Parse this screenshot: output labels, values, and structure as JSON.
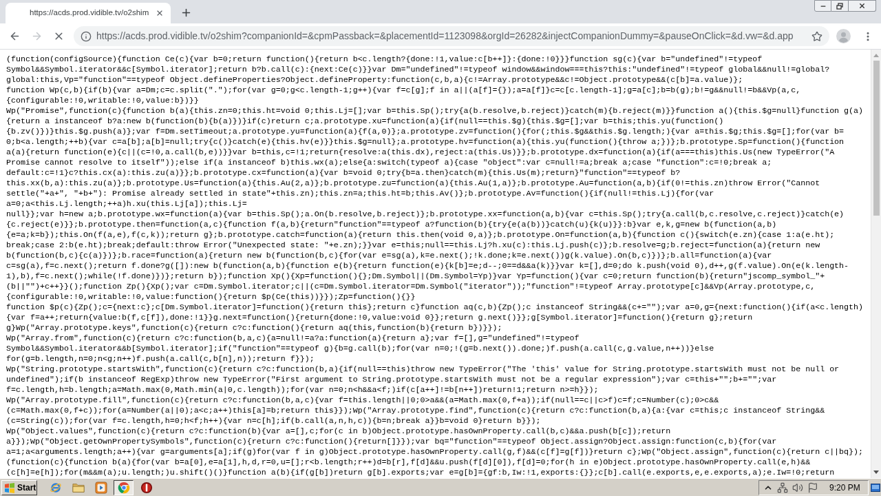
{
  "tabs": [
    {
      "title": "https://acds.prod.vidible.tv/o2shim",
      "selected": true
    }
  ],
  "toolbar": {
    "nav_buttons": [
      {
        "kind": "back",
        "disabled": false
      },
      {
        "kind": "forward",
        "disabled": true
      },
      {
        "kind": "stop",
        "disabled": false
      }
    ],
    "url": "https://acds.prod.vidible.tv/o2shim?companionId=&cpmPassback=&placementId=1123098&orgId=26282&injectCompanionDummy=&pauseOnClick=&d.vw=&d.app"
  },
  "page": {
    "code_lines": [
      "(function(configSource){function Ce(c){var b=0;return function(){return b<c.length?{done:!1,value:c[b++]}:{done:!0}}}function sg(c){var b=\"undefined\"!=typeof",
      "Symbol&&Symbol.iterator&&c[Symbol.iterator];return b?b.call(c):{next:Ce(c)}}var Dm=\"undefined\"!=typeof window&&window===this?this:\"undefined\"!=typeof global&&null!=global?",
      "global:this,Vp=\"function\"==typeof Object.defineProperties?Object.defineProperty:function(c,b,a){c!=Array.prototype&&c!=Object.prototype&&(c[b]=a.value)};",
      "function Wp(c,b){if(b){var a=Dm;c=c.split(\".\");for(var g=0;g<c.length-1;g++){var f=c[g];f in a||(a[f]={});a=a[f]}c=c[c.length-1];g=a[c];b=b(g);b!=g&&null!=b&&Vp(a,c,",
      "{configurable:!0,writable:!0,value:b})}}",
      "Wp(\"Promise\",function(c){function b(a){this.zn=0;this.ht=void 0;this.Lj=[];var b=this.Sp();try{a(b.resolve,b.reject)}catch(m){b.reject(m)}}function a(){this.$g=null}function g(a)",
      "{return a instanceof b?a:new b(function(b){b(a)})}if(c)return c;a.prototype.xu=function(a){if(null==this.$g){this.$g=[];var b=this;this.yu(function()",
      "{b.zv()})}this.$g.push(a)};var f=Dm.setTimeout;a.prototype.yu=function(a){f(a,0)};a.prototype.zv=function(){for(;this.$g&&this.$g.length;){var a=this.$g;this.$g=[];for(var b=",
      "0;b<a.length;++b){var c=a[b];a[b]=null;try{c()}catch(e){this.hv(e)}}this.$g=null};a.prototype.hv=function(a){this.yu(function(){throw a;})};b.prototype.Sp=function(){function",
      "a(a){return function(e){c||(c=!0,a.call(b,e))}}var b=this,c=!1;return{resolve:a(this.dx),reject:a(this.Us)}};b.prototype.dx=function(a){if(a===this)this.Us(new TypeError(\"A",
      "Promise cannot resolve to itself\"));else if(a instanceof b)this.wx(a);else{a:switch(typeof a){case \"object\":var c=null!=a;break a;case \"function\":c=!0;break a;",
      "default:c=!1}c?this.cx(a):this.zu(a)}};b.prototype.cx=function(a){var b=void 0;try{b=a.then}catch(m){this.Us(m);return}\"function\"==typeof b?",
      "this.xx(b,a):this.zu(a)};b.prototype.Us=function(a){this.Au(2,a)};b.prototype.zu=function(a){this.Au(1,a)};b.prototype.Au=function(a,b){if(0!=this.zn)throw Error(\"Cannot",
      "settle(\"+a+\", \"+b+\"): Promise already settled in state\"+this.zn);this.zn=a;this.ht=b;this.Av()};b.prototype.Av=function(){if(null!=this.Lj){for(var",
      "a=0;a<this.Lj.length;++a)h.xu(this.Lj[a]);this.Lj=",
      "null}};var h=new a;b.prototype.wx=function(a){var b=this.Sp();a.On(b.resolve,b.reject)};b.prototype.xx=function(a,b){var c=this.Sp();try{a.call(b,c.resolve,c.reject)}catch(e)",
      "{c.reject(e)}};b.prototype.then=function(a,c){function f(a,b){return\"function\"==typeof a?function(b){try{e(a(b))}catch(u){k(u)}}:b}var e,k,g=new b(function(a,b)",
      "{e=a;k=b});this.On(f(a,e),f(c,k));return g};b.prototype.catch=function(a){return this.then(void 0,a)};b.prototype.On=function(a,b){function c(){switch(e.zn){case 1:a(e.ht);",
      "break;case 2:b(e.ht);break;default:throw Error(\"Unexpected state: \"+e.zn);}}var e=this;null==this.Lj?h.xu(c):this.Lj.push(c)};b.resolve=g;b.reject=function(a){return new",
      "b(function(b,c){c(a)})};b.race=function(a){return new b(function(b,c){for(var e=sg(a),k=e.next();!k.done;k=e.next())g(k.value).On(b,c)})};b.all=function(a){var",
      "c=sg(a),f=c.next();return f.done?g([]):new b(function(a,b){function e(b){return function(e){k[b]=e;d--;0==d&&a(k)}}var k=[],d=0;do k.push(void 0),d++,g(f.value).On(e(k.length-",
      "1),b),f=c.next();while(!f.done)})};return b});function Xp(){Xp=function(){};Dm.Symbol||(Dm.Symbol=Yp)}var Yp=function(){var c=0;return function(b){return\"jscomp_symbol_\"+",
      "(b||\"\")+c++}}();function Zp(){Xp();var c=Dm.Symbol.iterator;c||(c=Dm.Symbol.iterator=Dm.Symbol(\"iterator\"));\"function\"!=typeof Array.prototype[c]&&Vp(Array.prototype,c,",
      "{configurable:!0,writable:!0,value:function(){return $p(Ce(this))}});Zp=function(){}}",
      "function $p(c){Zp();c={next:c};c[Dm.Symbol.iterator]=function(){return this};return c}function aq(c,b){Zp();c instanceof String&&(c+=\"\");var a=0,g={next:function(){if(a<c.length)",
      "{var f=a++;return{value:b(f,c[f]),done:!1}}g.next=function(){return{done:!0,value:void 0}};return g.next()}};g[Symbol.iterator]=function(){return g};return",
      "g}Wp(\"Array.prototype.keys\",function(c){return c?c:function(){return aq(this,function(b){return b})}});",
      "Wp(\"Array.from\",function(c){return c?c:function(b,a,c){a=null!=a?a:function(a){return a};var f=[],g=\"undefined\"!=typeof",
      "Symbol&&Symbol.iterator&&b[Symbol.iterator];if(\"function\"==typeof g){b=g.call(b);for(var n=0;!(g=b.next()).done;)f.push(a.call(c,g.value,n++))}else",
      "for(g=b.length,n=0;n<g;n++)f.push(a.call(c,b[n],n));return f}});",
      "Wp(\"String.prototype.startsWith\",function(c){return c?c:function(b,a){if(null==this)throw new TypeError(\"The 'this' value for String.prototype.startsWith must not be null or",
      "undefined\");if(b instanceof RegExp)throw new TypeError(\"First argument to String.prototype.startsWith must not be a regular expression\");var c=this+\"\";b+=\"\";var",
      "f=c.length,h=b.length;a=Math.max(0,Math.min(a|0,c.length));for(var n=0;n<h&&a<f;)if(c[a++]!=b[n++])return!1;return n>=h}});",
      "Wp(\"Array.prototype.fill\",function(c){return c?c:function(b,a,c){var f=this.length||0;0>a&&(a=Math.max(0,f+a));if(null==c||c>f)c=f;c=Number(c);0>c&&",
      "(c=Math.max(0,f+c));for(a=Number(a||0);a<c;a++)this[a]=b;return this}});Wp(\"Array.prototype.find\",function(c){return c?c:function(b,a){a:{var c=this;c instanceof String&&",
      "(c=String(c));for(var f=c.length,h=0;h<f;h++){var n=c[h];if(b.call(a,n,h,c)){b=n;break a}}b=void 0}return b}});",
      "Wp(\"Object.values\",function(c){return c?c:function(b){var a=[],c;for(c in b)Object.prototype.hasOwnProperty.call(b,c)&&a.push(b[c]);return",
      "a}});Wp(\"Object.getOwnPropertySymbols\",function(c){return c?c:function(){return[]}});var bq=\"function\"==typeof Object.assign?Object.assign:function(c,b){for(var",
      "a=1;a<arguments.length;a++){var g=arguments[a];if(g)for(var f in g)Object.prototype.hasOwnProperty.call(g,f)&&(c[f]=g[f])}return c};Wp(\"Object.assign\",function(c){return c||bq});",
      "(function(c){function b(a){for(var b=a[0],e=a[1],h,d,r=0,u=[];r<b.length;r++)d=b[r],f[d]&&u.push(f[d][0]),f[d]=0;for(h in e)Object.prototype.hasOwnProperty.call(e,h)&&",
      "(c[h]=e[h]);for(m&&m(a);u.length;)u.shift()()}function a(b){if(g[b])return g[b].exports;var e=g[b]={gf:b,Iw:!1,exports:{}};c[b].call(e.exports,e,e.exports,a);e.Iw=!0;return"
    ]
  },
  "taskbar": {
    "start_label": "Start",
    "apps": [
      {
        "kind": "ie",
        "selected": false
      },
      {
        "kind": "folder",
        "selected": false
      },
      {
        "kind": "media",
        "selected": false
      },
      {
        "kind": "chrome",
        "selected": true
      },
      {
        "kind": "alert",
        "selected": false
      }
    ],
    "clock": "9:20 PM"
  }
}
